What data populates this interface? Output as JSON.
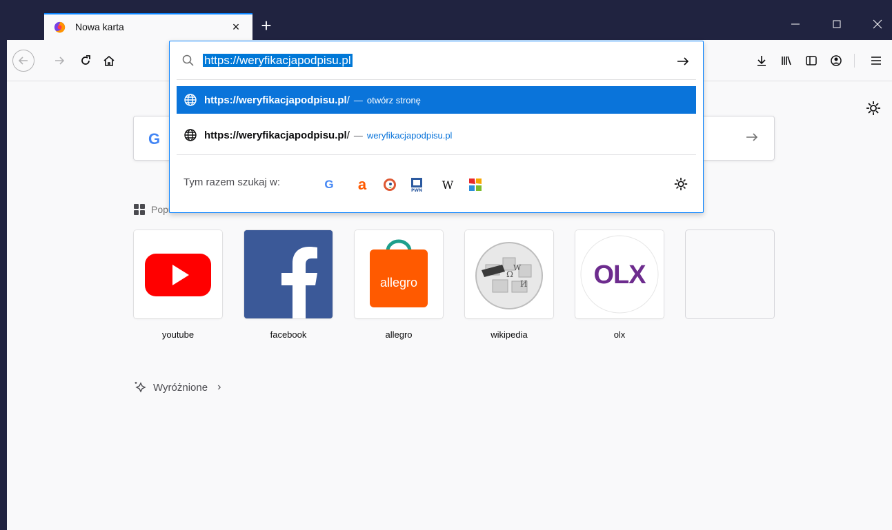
{
  "tab": {
    "title": "Nowa karta",
    "close": "×",
    "new_tab": "+"
  },
  "window": {
    "minimize": "—",
    "maximize": "☐",
    "close": "✕"
  },
  "urlbar": {
    "value": "https://weryfikacjapodpisu.pl",
    "results": [
      {
        "url": "https://weryfikacjapodpisu.pl",
        "suffix": "/",
        "separator": "—",
        "action": "otwórz stronę"
      },
      {
        "url": "https://weryfikacjapodpisu.pl",
        "suffix": "/",
        "separator": "—",
        "action": "weryfikacjapodpisu.pl"
      }
    ],
    "oneoff_label": "Tym razem szukaj w:",
    "engines": [
      "google-icon",
      "allegro-icon",
      "duckduckgo-icon",
      "pwn-icon",
      "wikipedia-icon",
      "ceneo-icon"
    ]
  },
  "newtab": {
    "search_logo": "G",
    "sections": {
      "top_sites": "Popularne",
      "highlights": "Wyróżnione"
    },
    "tiles": [
      {
        "label": "youtube"
      },
      {
        "label": "facebook"
      },
      {
        "label": "allegro",
        "logo_text": "allegro"
      },
      {
        "label": "wikipedia"
      },
      {
        "label": "olx",
        "logo_text": "OLX"
      },
      {
        "label": ""
      }
    ],
    "highlights_chevron": "›"
  },
  "colors": {
    "titlebar": "#202340",
    "accent": "#0a84ff",
    "selection": "#0a74da"
  }
}
